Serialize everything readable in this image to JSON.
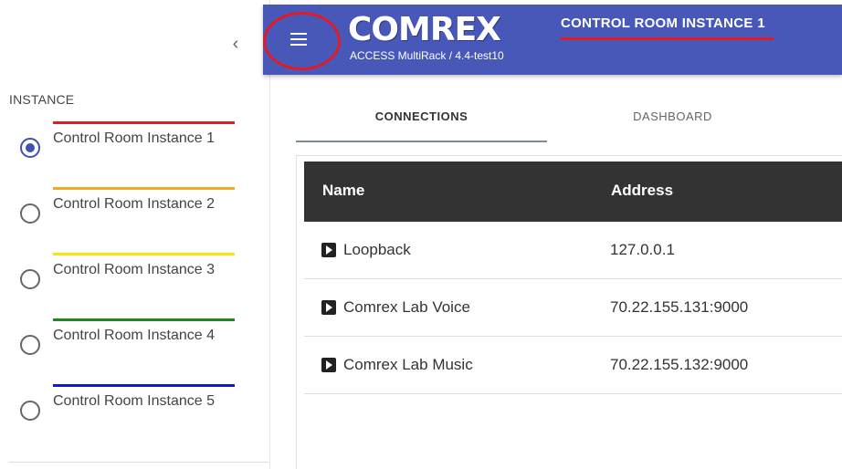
{
  "sidebar": {
    "collapse_icon": "chevron-left-icon",
    "section_title": "INSTANCE",
    "instances": [
      {
        "label": "Control Room Instance 1",
        "color": "#e01b24",
        "selected": true
      },
      {
        "label": "Control Room Instance 2",
        "color": "#f5a623",
        "selected": false
      },
      {
        "label": "Control Room Instance 3",
        "color": "#f2e60a",
        "selected": false
      },
      {
        "label": "Control Room Instance 4",
        "color": "#1e8a1e",
        "selected": false
      },
      {
        "label": "Control Room Instance 5",
        "color": "#1515d6",
        "selected": false
      }
    ]
  },
  "header": {
    "menu_icon": "hamburger-menu-icon",
    "logo_text": "COMREX",
    "subtitle": "ACCESS MultiRack / 4.4-test10",
    "instance_title": "CONTROL ROOM INSTANCE 1",
    "background": "#4858b8",
    "annotation_color": "#e01b24"
  },
  "tabs": [
    {
      "label": "CONNECTIONS",
      "active": true
    },
    {
      "label": "DASHBOARD",
      "active": false
    }
  ],
  "table": {
    "columns": [
      "Name",
      "Address"
    ],
    "rows": [
      {
        "name": "Loopback",
        "address": "127.0.0.1",
        "icon": "play-icon"
      },
      {
        "name": "Comrex Lab Voice",
        "address": "70.22.155.131:9000",
        "icon": "play-icon"
      },
      {
        "name": "Comrex Lab Music",
        "address": "70.22.155.132:9000",
        "icon": "play-icon"
      }
    ]
  }
}
